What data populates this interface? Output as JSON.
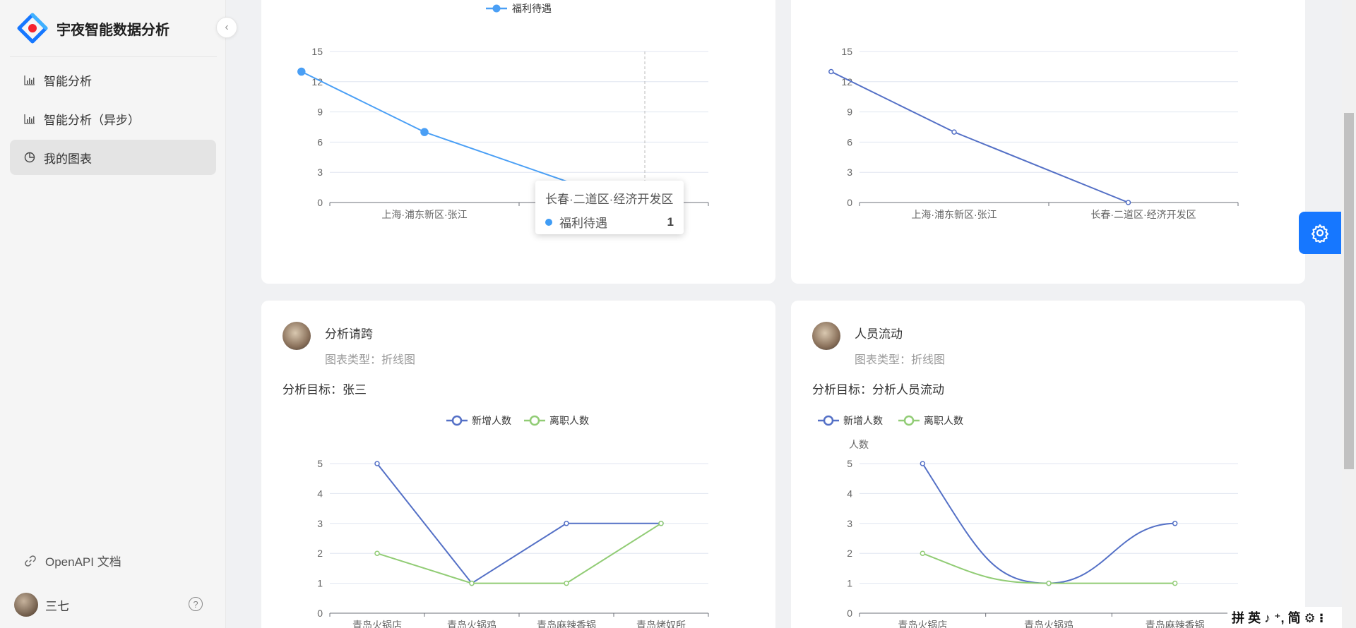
{
  "brand": {
    "title": "宇夜智能数据分析"
  },
  "menu": [
    {
      "label": "智能分析",
      "icon": "bar-chart-icon"
    },
    {
      "label": "智能分析（异步）",
      "icon": "bar-chart-icon"
    },
    {
      "label": "我的图表",
      "icon": "pie-chart-icon",
      "active": true
    }
  ],
  "openapi": {
    "label": "OpenAPI 文档"
  },
  "user": {
    "name": "三七"
  },
  "cards": [
    {
      "legend": [
        "福利待遇"
      ]
    },
    {
      "legend": []
    },
    {
      "title": "分析请跨",
      "type_line": "图表类型：折线图",
      "goal": "分析目标：张三",
      "legend": [
        "新增人数",
        "离职人数"
      ]
    },
    {
      "title": "人员流动",
      "type_line": "图表类型：折线图",
      "goal": "分析目标：分析人员流动",
      "legend": [
        "新增人数",
        "离职人数"
      ],
      "ylabel": "人数"
    }
  ],
  "tooltip": {
    "title": "长春·二道区·经济开发区",
    "series": "福利待遇",
    "value": "1"
  },
  "ime": {
    "text": "拼 英 ♪ ⁺, 简 ⚙ ⁝"
  },
  "colors": {
    "accent": "#1677ff",
    "blue_series": "#4a9ff5",
    "dark_series": "#5470c6",
    "green_series": "#91cc75"
  },
  "chart_data": [
    {
      "type": "line",
      "categories": [
        "上海·浦东新区·张江",
        "长春·二道区·经济开发区"
      ],
      "series": [
        {
          "name": "福利待遇",
          "x": [
            0.35,
            1.0,
            2.0
          ],
          "values": [
            13,
            7,
            1
          ]
        }
      ],
      "xlabels": [
        "上海·浦东新区·张江",
        "长春·二道区·经济开发区"
      ],
      "yticks": [
        0,
        3,
        6,
        9,
        12,
        15
      ],
      "ylim": [
        0,
        15
      ]
    },
    {
      "type": "line",
      "categories": [
        "上海·浦东新区·张江",
        "长春·二道区·经济开发区"
      ],
      "series": [
        {
          "name": "",
          "x": [
            0.35,
            1.0,
            2.0
          ],
          "values": [
            13,
            7,
            0
          ]
        }
      ],
      "xlabels": [
        "上海·浦东新区·张江",
        "长春·二道区·经济开发区"
      ],
      "yticks": [
        0,
        3,
        6,
        9,
        12,
        15
      ],
      "ylim": [
        0,
        15
      ]
    },
    {
      "type": "line",
      "categories": [
        "青岛火锅店",
        "青岛火锅鸡",
        "青岛麻辣香锅",
        "青岛烤奴所"
      ],
      "series": [
        {
          "name": "新增人数",
          "values": [
            5,
            1,
            3,
            3
          ]
        },
        {
          "name": "离职人数",
          "values": [
            2,
            1,
            1,
            3
          ]
        }
      ],
      "yticks": [
        0,
        1,
        2,
        3,
        4,
        5
      ],
      "ylim": [
        0,
        5
      ]
    },
    {
      "type": "line",
      "smooth": true,
      "categories": [
        "青岛火锅店",
        "青岛火锅鸡",
        "青岛麻辣香锅"
      ],
      "series": [
        {
          "name": "新增人数",
          "values": [
            5,
            1,
            3
          ]
        },
        {
          "name": "离职人数",
          "values": [
            2,
            1,
            1
          ]
        }
      ],
      "ylabel": "人数",
      "yticks": [
        0,
        1,
        2,
        3,
        4,
        5
      ],
      "ylim": [
        0,
        5
      ]
    }
  ]
}
